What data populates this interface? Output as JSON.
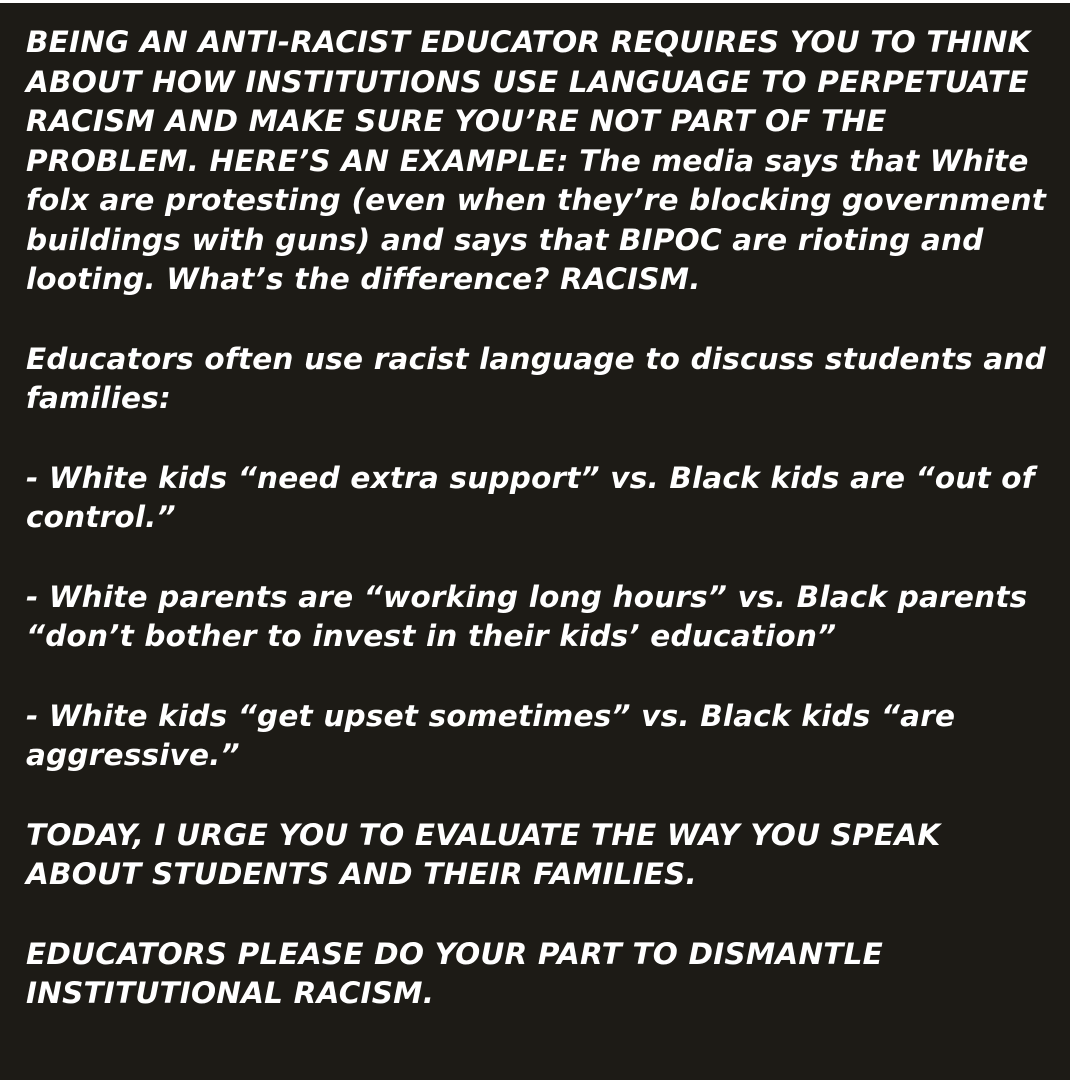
{
  "post": {
    "p1_caps": "BEING AN ANTI-RACIST EDUCATOR REQUIRES YOU TO THINK ABOUT HOW INSTITUTIONS USE LANGUAGE TO PERPETUATE RACISM AND MAKE SURE YOU’RE NOT PART OF THE PROBLEM. HERE’S AN EXAMPLE:",
    "p1_rest": " The media says that White folx are protesting (even when they’re blocking government buildings with guns) and says that BIPOC are rioting and looting. What’s the difference? RACISM.",
    "p2": "Educators often use racist language to discuss students and families:",
    "p3": "- White kids “need extra support” vs. Black kids are “out of control.”",
    "p4": "- White parents are “working long hours” vs. Black parents “don’t bother to invest in their kids’ education”",
    "p5": "- White kids “get upset sometimes” vs. Black kids “are aggressive.”",
    "p6": "TODAY, I URGE YOU TO EVALUATE THE WAY YOU SPEAK ABOUT STUDENTS AND THEIR FAMILIES.",
    "p7": "EDUCATORS PLEASE DO YOUR PART TO DISMANTLE INSTITUTIONAL RACISM."
  }
}
